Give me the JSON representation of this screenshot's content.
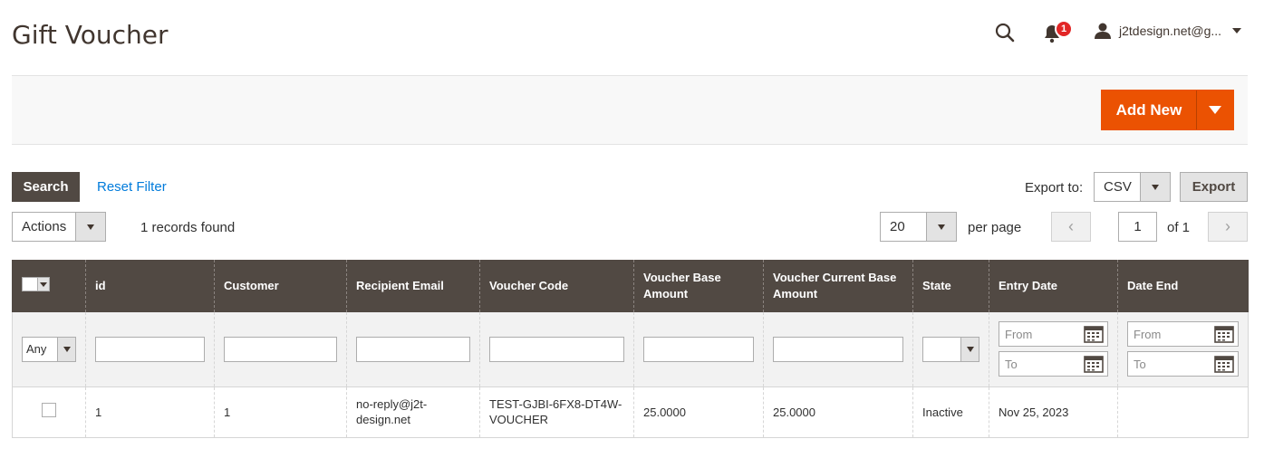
{
  "header": {
    "title": "Gift Voucher",
    "notification_count": "1",
    "user_name": "j2tdesign.net@g..."
  },
  "page_actions": {
    "add_new_label": "Add New"
  },
  "toolbar": {
    "search_label": "Search",
    "reset_label": "Reset Filter",
    "export_label": "Export to:",
    "export_format": "CSV",
    "export_button": "Export",
    "actions_label": "Actions",
    "records_found": "1 records found",
    "per_page_value": "20",
    "per_page_label": "per page",
    "page_current": "1",
    "page_total": "of 1",
    "prev_symbol": "‹",
    "next_symbol": "›"
  },
  "grid": {
    "columns": [
      "id",
      "Customer",
      "Recipient Email",
      "Voucher Code",
      "Voucher Base Amount",
      "Voucher Current Base Amount",
      "State",
      "Entry Date",
      "Date End"
    ],
    "filters": {
      "select_any": "Any",
      "date_from": "From",
      "date_to": "To"
    },
    "rows": [
      {
        "id": "1",
        "customer": "1",
        "recipient_email": "no-reply@j2t-design.net",
        "voucher_code": "TEST-GJBI-6FX8-DT4W-VOUCHER",
        "base_amount": "25.0000",
        "current_amount": "25.0000",
        "state": "Inactive",
        "entry_date": "Nov 25, 2023",
        "date_end": ""
      }
    ]
  },
  "colors": {
    "accent": "#eb5202",
    "header_bg": "#514943",
    "link": "#007bdb"
  }
}
